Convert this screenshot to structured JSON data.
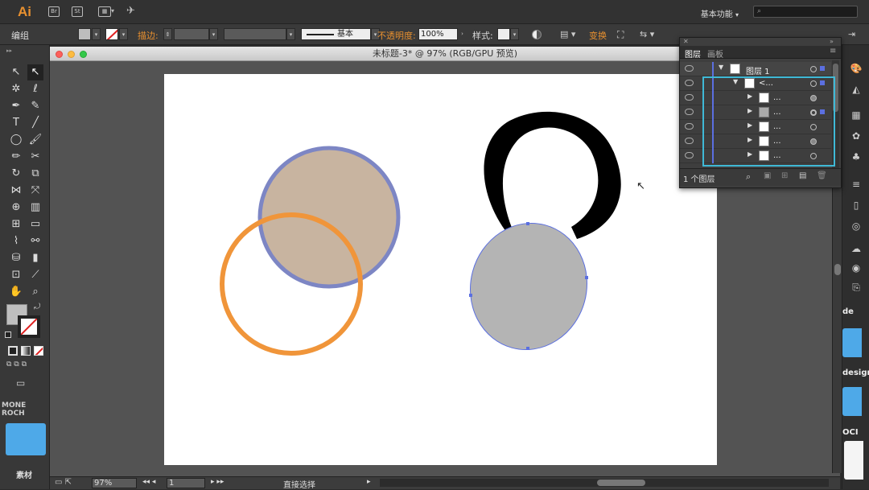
{
  "app": {
    "logo": "Ai",
    "workspace": "基本功能",
    "search_placeholder": ""
  },
  "control_bar": {
    "mode": "编组",
    "stroke_label": "描边:",
    "stroke_style": "基本",
    "opacity_label": "不透明度:",
    "opacity_value": "100%",
    "style_label": "样式:",
    "transform_label": "变换"
  },
  "document": {
    "title": "未标题-3* @ 97% (RGB/GPU 预览)"
  },
  "status": {
    "zoom": "97%",
    "artboard": "1",
    "tool": "直接选择"
  },
  "layers_panel": {
    "tabs": [
      "图层",
      "画板"
    ],
    "rows": [
      {
        "name": "图层 1",
        "indent": 0
      },
      {
        "name": "<...",
        "indent": 1
      },
      {
        "name": "...",
        "indent": 2
      },
      {
        "name": "...",
        "indent": 2
      },
      {
        "name": "...",
        "indent": 2
      },
      {
        "name": "...",
        "indent": 2
      },
      {
        "name": "...",
        "indent": 2
      }
    ],
    "footer_count": "1 个图层"
  },
  "left_side": {
    "label_top": "MONE ROCH",
    "folder_label": "素材"
  },
  "right_side": {
    "label1": "de",
    "label2": "design",
    "label3": "OCI"
  },
  "colors": {
    "accent_orange": "#e8902f",
    "selection_blue": "#5b6fe0",
    "highlight_cyan": "#3fb9d6",
    "circle_fill": "#c8b4a0",
    "circle_stroke": "#7d86c4",
    "orange_ring": "#f0953a",
    "grey_oval": "#b4b4b4"
  }
}
